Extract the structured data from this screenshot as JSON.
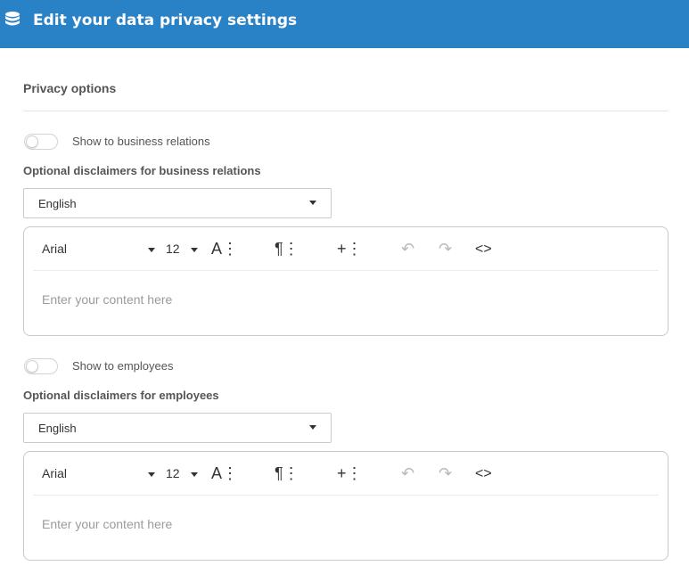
{
  "header": {
    "title": "Edit your data privacy settings",
    "icon": "database-icon",
    "background": "#2a82c6"
  },
  "section": {
    "title": "Privacy options"
  },
  "business": {
    "toggle_label": "Show to business relations",
    "toggle_on": false,
    "disclaimer_label": "Optional disclaimers for business relations",
    "language": "English",
    "editor": {
      "font": "Arial",
      "font_size": "12",
      "placeholder": "Enter your content here"
    }
  },
  "employees": {
    "toggle_label": "Show to employees",
    "toggle_on": false,
    "disclaimer_label": "Optional disclaimers for employees",
    "language": "English",
    "editor": {
      "font": "Arial",
      "font_size": "12",
      "placeholder": "Enter your content here"
    }
  },
  "toolbar_icons": [
    "font-style-icon",
    "paragraph-icon",
    "insert-icon",
    "undo-icon",
    "redo-icon",
    "code-view-icon"
  ]
}
